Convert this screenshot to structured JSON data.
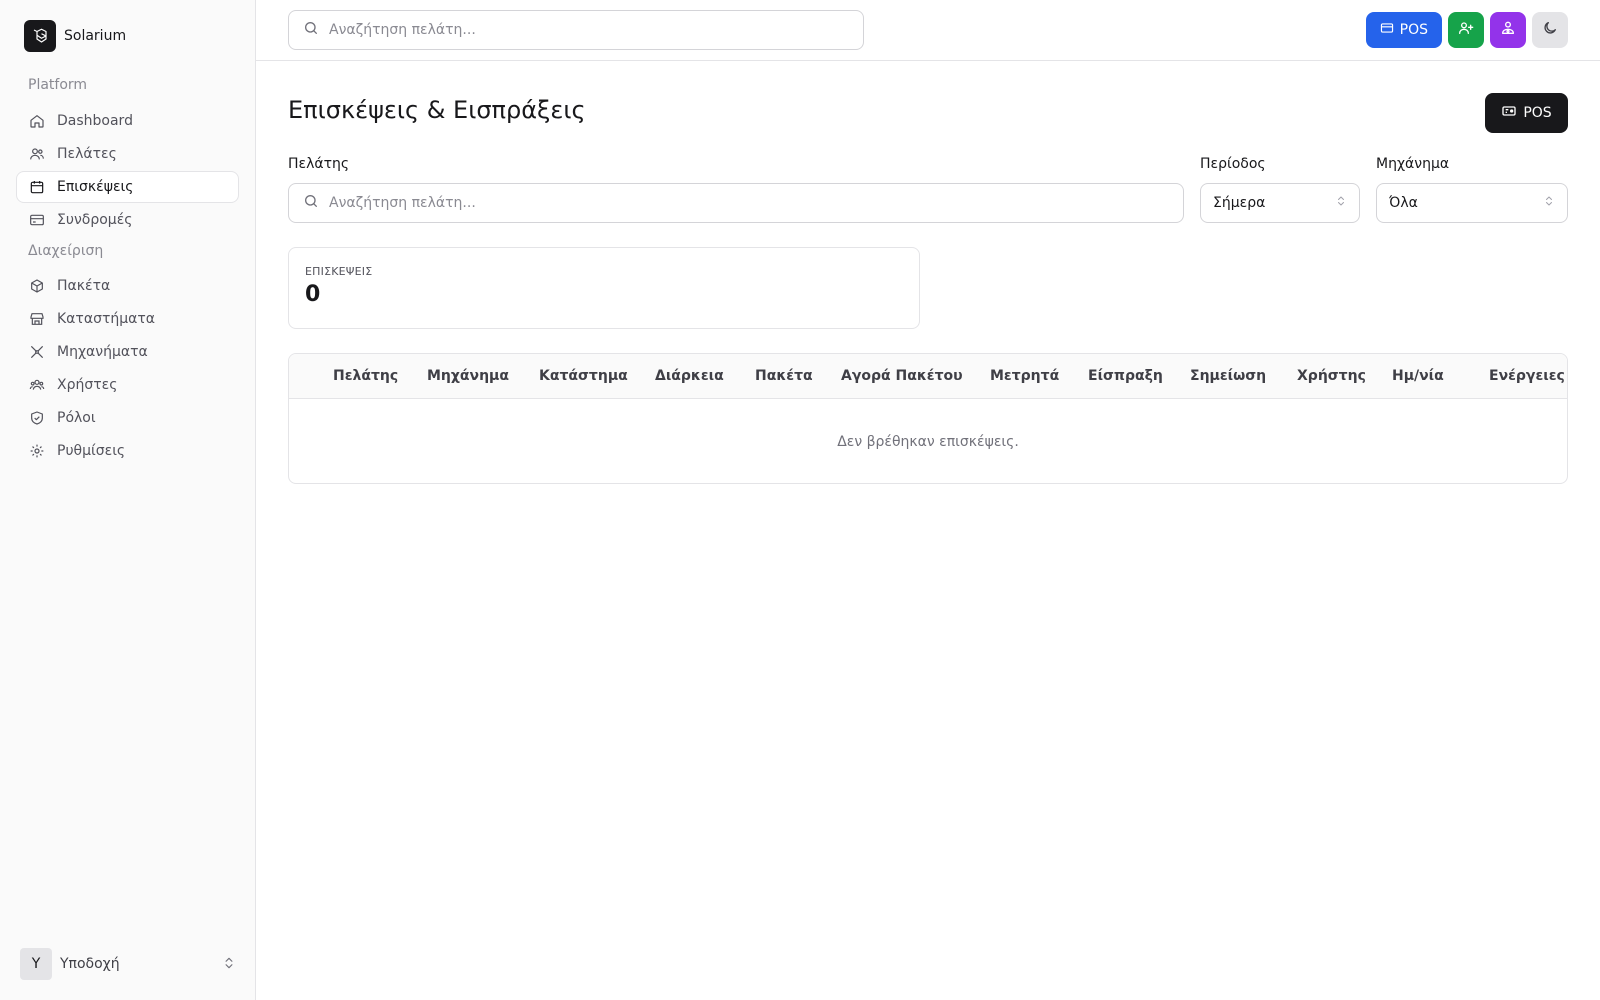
{
  "app": {
    "name": "Solarium"
  },
  "sidebar": {
    "groups": [
      {
        "label": "Platform"
      },
      {
        "label": "Διαχείριση"
      }
    ],
    "items": [
      {
        "label": "Dashboard",
        "icon": "home-icon"
      },
      {
        "label": "Πελάτες",
        "icon": "users-icon"
      },
      {
        "label": "Επισκέψεις",
        "icon": "calendar-icon",
        "active": true
      },
      {
        "label": "Συνδρομές",
        "icon": "credit-card-icon"
      },
      {
        "label": "Πακέτα",
        "icon": "package-icon"
      },
      {
        "label": "Καταστήματα",
        "icon": "store-icon"
      },
      {
        "label": "Μηχανήματα",
        "icon": "tools-icon"
      },
      {
        "label": "Χρήστες",
        "icon": "user-group-icon"
      },
      {
        "label": "Ρόλοι",
        "icon": "shield-icon"
      },
      {
        "label": "Ρυθμίσεις",
        "icon": "gear-icon"
      }
    ],
    "user": {
      "initial": "Y",
      "name": "Υποδοχή"
    }
  },
  "topbar": {
    "search_placeholder": "Αναζήτηση πελάτη...",
    "pos_label": "POS",
    "colors": {
      "blue": "#2563eb",
      "green": "#16a34a",
      "purple": "#9333ea"
    }
  },
  "main": {
    "title": "Επισκέψεις & Εισπράξεις",
    "pos_label": "POS",
    "filters": {
      "customer_label": "Πελάτης",
      "customer_placeholder": "Αναζήτηση πελάτη...",
      "period_label": "Περίοδος",
      "period_value": "Σήμερα",
      "machine_label": "Μηχάνημα",
      "machine_value": "Όλα"
    },
    "stats": {
      "label": "ΕΠΙΣΚΕΨΕΙΣ",
      "value": "0"
    },
    "table": {
      "columns": [
        "Πελάτης",
        "Μηχάνημα",
        "Κατάστημα",
        "Διάρκεια",
        "Πακέτα",
        "Αγορά Πακέτου",
        "Μετρητά",
        "Είσπραξη",
        "Σημείωση",
        "Χρήστης",
        "Ημ/νία",
        "Ενέργειες"
      ],
      "empty_message": "Δεν βρέθηκαν επισκέψεις."
    }
  }
}
